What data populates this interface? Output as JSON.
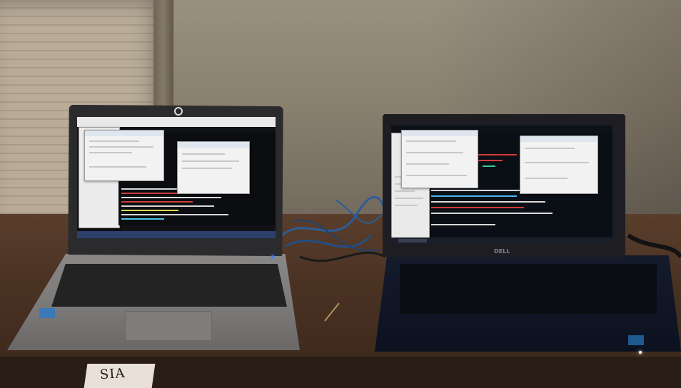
{
  "scene": {
    "description_free": true
  },
  "book": {
    "spine_text": "SIA"
  },
  "left_laptop": {
    "taskbar_color": "#2d3f6b",
    "terminal_colors": [
      "#d9d9d9",
      "#c93b3b",
      "#e0d44a",
      "#4ec5e6"
    ],
    "led_color": "#3d7fff"
  },
  "right_laptop": {
    "brand": "DELL",
    "taskbar_color": "#1b1f29",
    "terminal_colors": [
      "#d9d9d9",
      "#d13a3a",
      "#2fd09a",
      "#46b8f0"
    ]
  },
  "colors": {
    "wall": "#8a8070",
    "desk": "#4a3223",
    "cable": "#2b5d99"
  }
}
